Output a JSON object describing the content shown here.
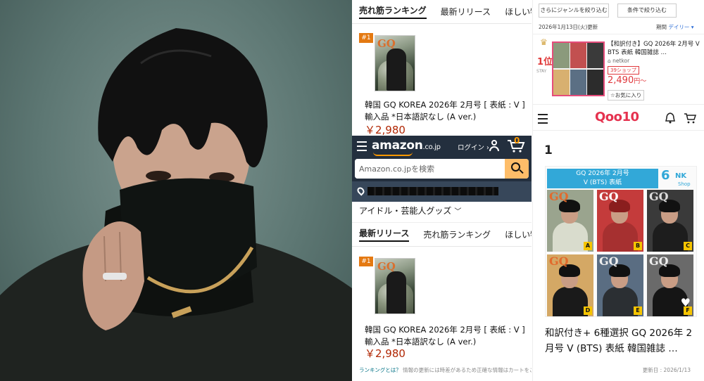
{
  "amazon": {
    "top_tabs": [
      "売れ筋ランキング",
      "最新リリース",
      "ほしい物ランキング"
    ],
    "top_product": {
      "rank": "#1",
      "title": "韓国 GQ KOREA 2026年 2月号 [ 表紙 : V ] 輸入品 *日本語訳なし (A ver.)",
      "price": "￥2,980"
    },
    "header": {
      "logo": "amazon",
      "logo_suffix": ".co.jp",
      "login": "ログイン ›",
      "cart_count": "0",
      "search_placeholder": "Amazon.co.jpを検索"
    },
    "category": "アイドル・芸能人グッズ",
    "tabs": [
      "最新リリース",
      "売れ筋ランキング",
      "ほしい物ランキング"
    ],
    "product": {
      "rank": "#1",
      "title": "韓国 GQ KOREA 2026年 2月号 [ 表紙 : V ] 輸入品 *日本語訳なし (A ver.)",
      "price": "￥2,980"
    },
    "footer": {
      "link": "ランキングとは？",
      "note": "情報の更新には時差があるため正確な情報はカートをご確認ください"
    }
  },
  "qoo10": {
    "filter_genre": "さらにジャンルを絞り込む",
    "filter_condition": "条件で絞り込む",
    "updated": "2026年1月13日(火)更新",
    "period_label": "期間",
    "period_value": "デイリー",
    "rank_item": {
      "rank": "1位",
      "dash": "–",
      "stay": "STAY",
      "title": "【和訳付き】GQ 2026年 2月号 V BTS 表紙 韓国雑誌 …",
      "seller": "netkor",
      "badge": "39ショップ",
      "price": "2,490",
      "price_unit": "円〜",
      "favorite": "☆お気に入り"
    },
    "logo": "Qoo10",
    "rank_number": "1",
    "card": {
      "head_line1": "GQ 2026年 2月号",
      "head_line2": "V (BTS) 表紙",
      "shop_six": "6",
      "shop_nk": "NK",
      "shop_text": "Shop",
      "cover_letters": [
        "A",
        "B",
        "C",
        "D",
        "E",
        "F"
      ],
      "cover_text": [
        "GQ",
        "GQ",
        "GQ",
        "GQ",
        "GQ",
        "GQ"
      ]
    },
    "product_title": "和訳付き+ 6種選択 GQ 2026年 2月号 V (BTS) 表紙 韓国雑誌 …",
    "footer_updated": "更新日 : 2026/1/13"
  },
  "colors": {
    "amazon_dark": "#232f3e",
    "amazon_orange": "#ff9900",
    "price_red": "#b12704",
    "qoo10_red": "#e5324f",
    "qoo10_blue": "#32a8d8"
  }
}
